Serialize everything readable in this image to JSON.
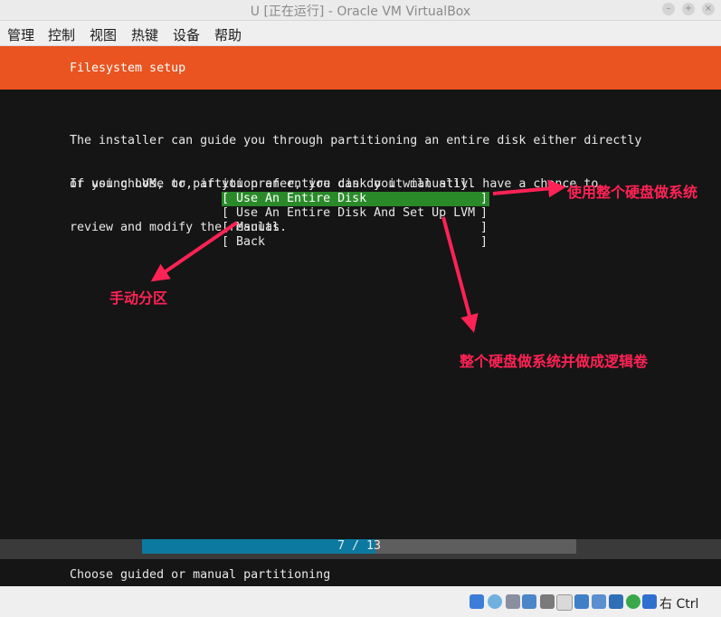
{
  "window": {
    "title": "U [正在运行] - Oracle VM VirtualBox"
  },
  "menu": [
    "管理",
    "控制",
    "视图",
    "热键",
    "设备",
    "帮助"
  ],
  "installer": {
    "header": "Filesystem setup",
    "paragraph1": [
      "The installer can guide you through partitioning an entire disk either directly",
      "or using LVM, or, if you prefer, you can do it manually."
    ],
    "paragraph2": [
      "If you choose to partition an entire disk you will still have a chance to",
      "review and modify the results."
    ],
    "options": [
      {
        "label": "Use An Entire Disk",
        "selected": true
      },
      {
        "label": "Use An Entire Disk And Set Up LVM",
        "selected": false
      },
      {
        "label": "Manual",
        "selected": false
      },
      {
        "label": "Back",
        "selected": false
      }
    ],
    "bracket_open": "[",
    "bracket_close": "]",
    "progress": {
      "text": "7 / 13",
      "current": 7,
      "total": 13
    },
    "status": "Choose guided or manual partitioning"
  },
  "annotations": {
    "entire_disk": "使用整个硬盘做系统",
    "manual": "手动分区",
    "lvm": "整个硬盘做系统并做成逻辑卷"
  },
  "annotation_color": "#ff2255",
  "colors": {
    "header": "#e95420",
    "selection": "#2a8a2a",
    "progress_fill": "#0b79a0"
  },
  "statusbar": {
    "icons": [
      "hard-disk-icon",
      "optical-drive-icon",
      "audio-icon",
      "network-icon",
      "usb-icon",
      "shared-folder-icon",
      "display-icon",
      "capture-icon",
      "recording-icon",
      "cpu-icon",
      "mouse-integration-icon",
      "keyboard-arrow-icon"
    ],
    "host_key": "右 Ctrl"
  }
}
